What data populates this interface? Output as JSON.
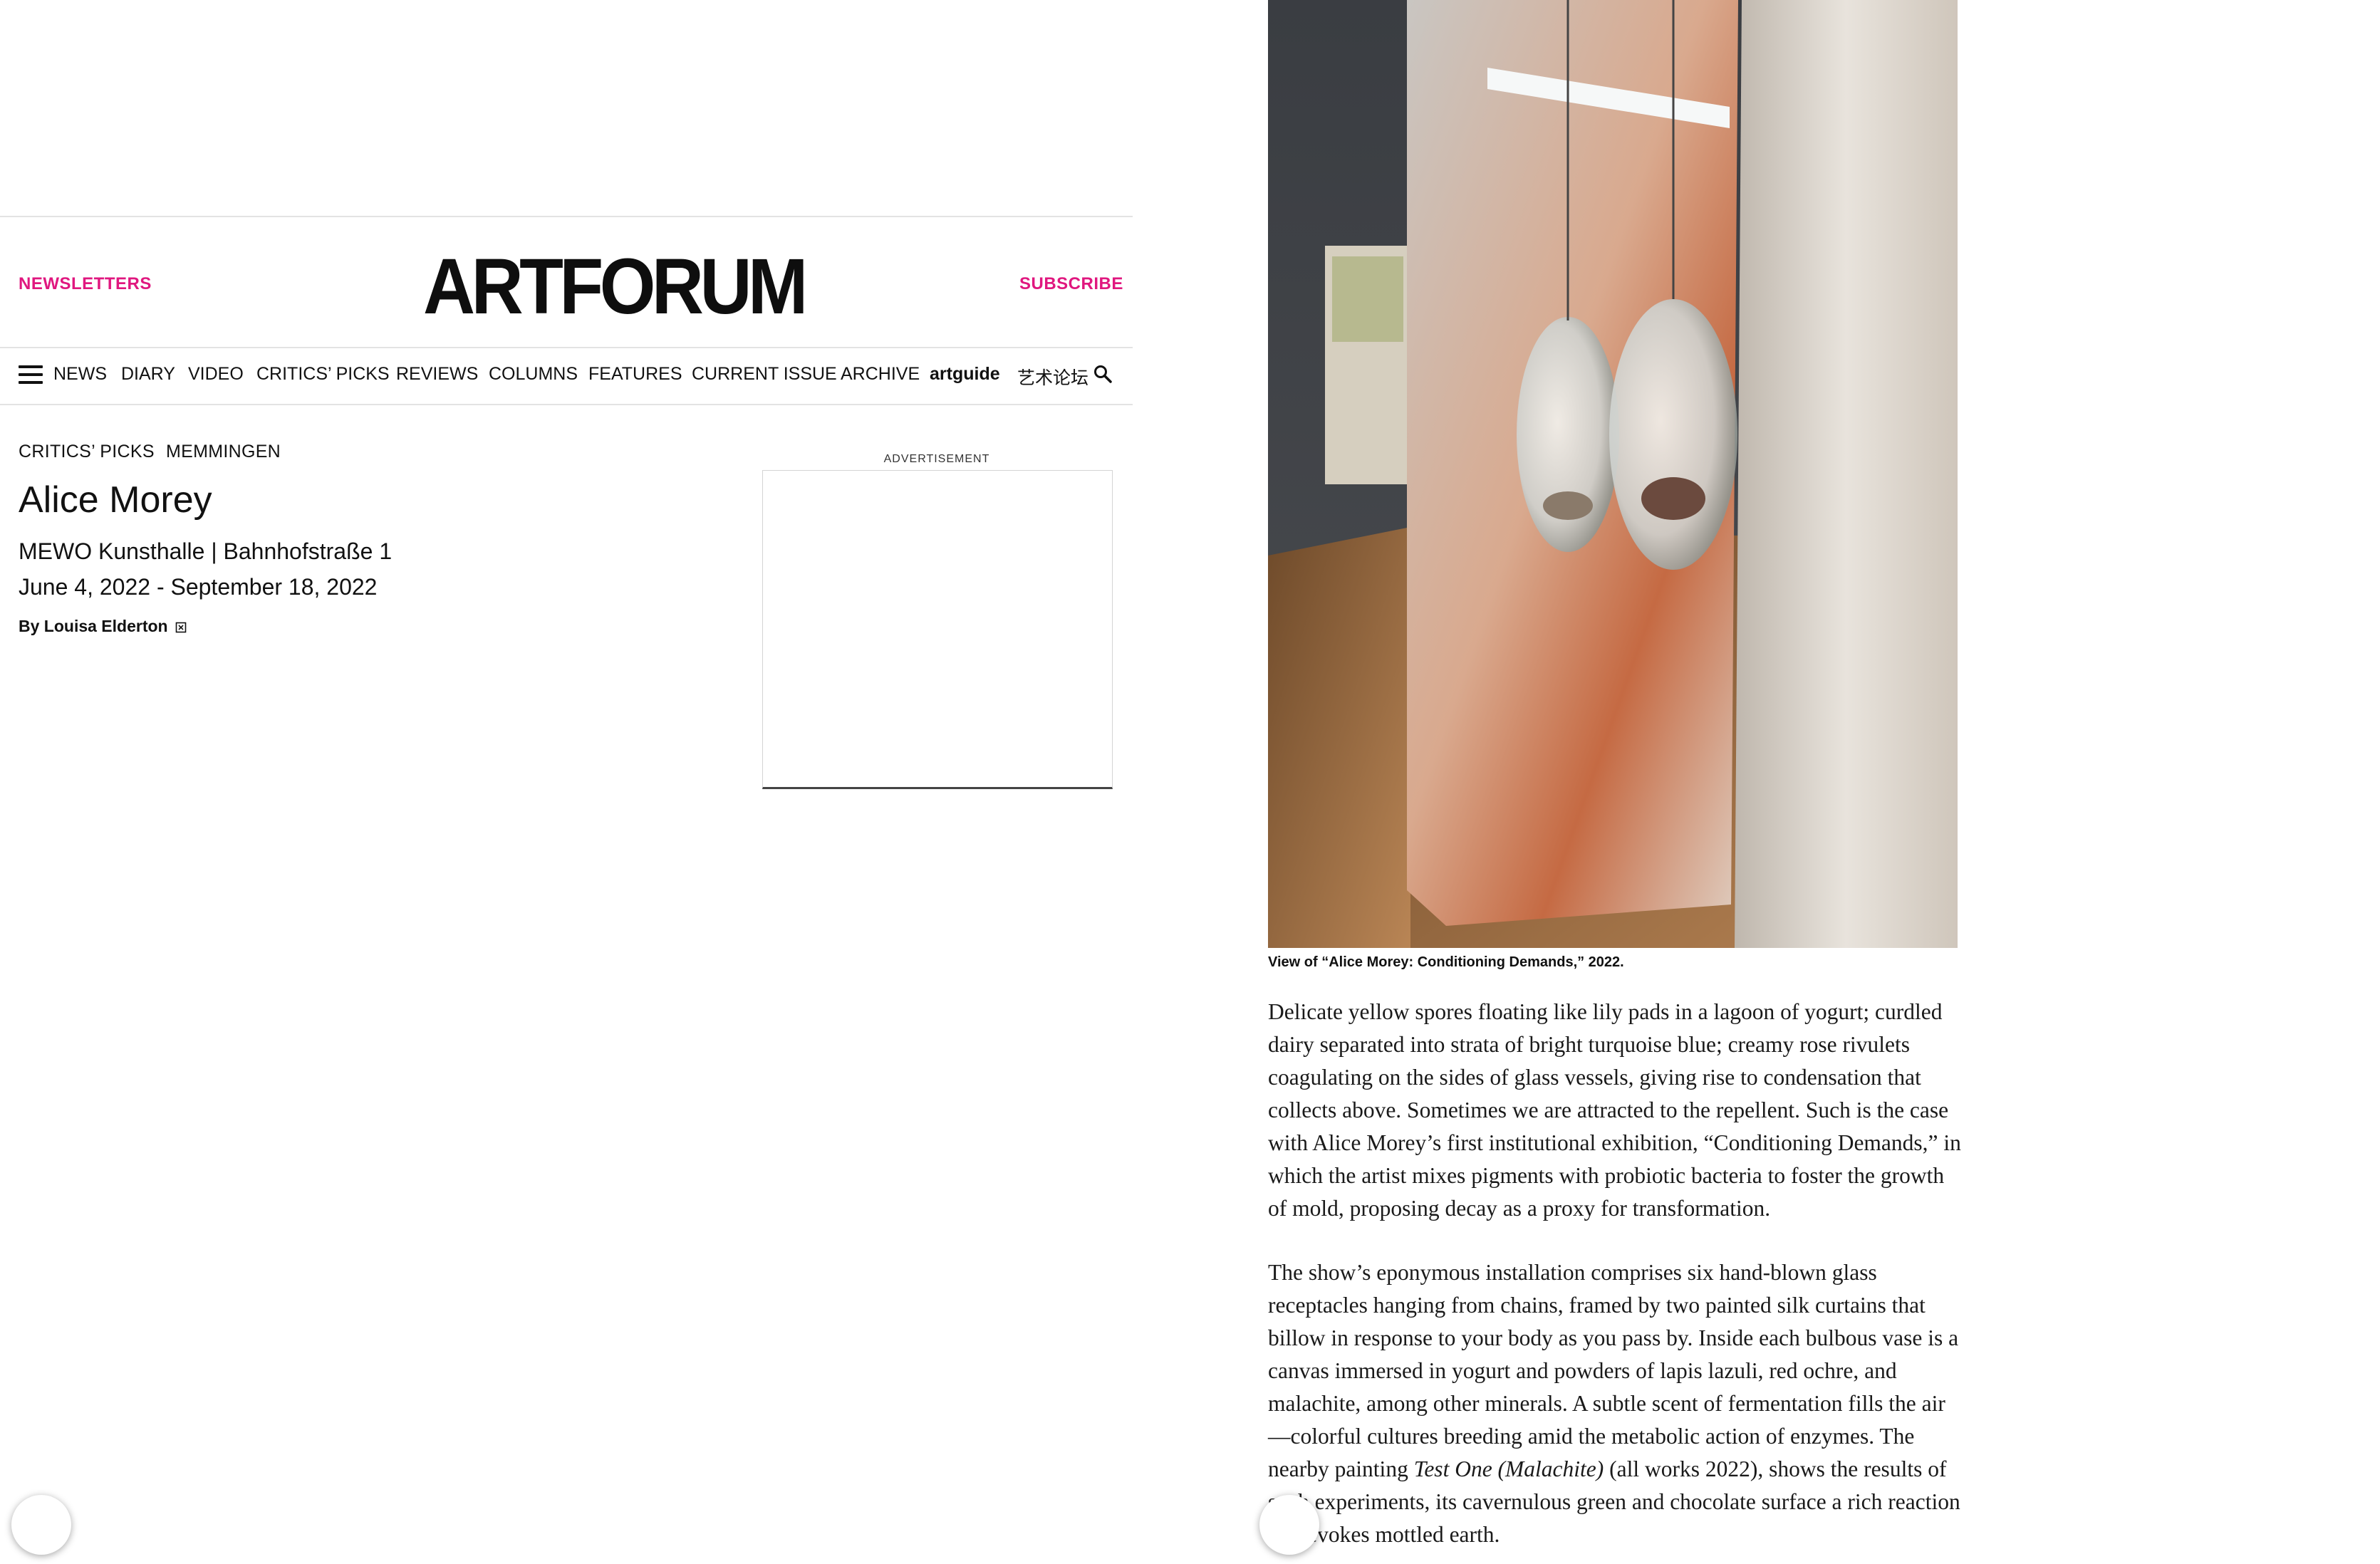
{
  "header": {
    "newsletters_label": "NEWSLETTERS",
    "logo_text": "ARTFORUM",
    "subscribe_label": "SUBSCRIBE",
    "accent_color": "#e0177f"
  },
  "nav": {
    "items": [
      "NEWS",
      "DIARY",
      "VIDEO",
      "CRITICS’ PICKS",
      "REVIEWS",
      "COLUMNS",
      "FEATURES",
      "CURRENT ISSUE",
      "ARCHIVE",
      "artguide",
      "艺术论坛"
    ],
    "menu_icon": "hamburger-menu-icon",
    "search_icon": "search-icon"
  },
  "article_meta": {
    "section": "CRITICS’ PICKS",
    "city": "MEMMINGEN",
    "title": "Alice Morey",
    "venue": "MEWO Kunsthalle | Bahnhofstraße 1",
    "dates": "June 4, 2022 - September 18, 2022",
    "byline": "By Louisa Elderton"
  },
  "advertisement": {
    "label": "ADVERTISEMENT"
  },
  "image": {
    "caption": "View of “Alice Morey: Conditioning Demands,” 2022."
  },
  "body": {
    "p1": "Delicate yellow spores floating like lily pads in a lagoon of yogurt; curdled dairy separated into strata of bright turquoise blue; creamy rose rivulets coagulating on the sides of glass vessels, giving rise to condensation that collects above. Sometimes we are attracted to the repellent. Such is the case with Alice Morey’s first institutional exhibition, “Conditioning Demands,” in which the artist mixes pigments with probiotic bacteria to foster the growth of mold, proposing decay as a proxy for transformation.",
    "p2_a": "The show’s eponymous installation comprises six hand-blown glass receptacles hanging from chains, framed by two painted silk curtains that billow in response to your body as you pass by. Inside each bulbous vase is a canvas immersed in yogurt and powders of lapis lazuli, red ochre, and malachite, among other minerals. A subtle scent of fermentation fills the air—colorful cultures breeding amid the metabolic action of enzymes. The nearby painting ",
    "p2_italic": "Test One (Malachite)",
    "p2_b": " (all works 2022), shows the results of such experiments, its cavernulous green and chocolate surface a rich reaction that evokes mottled earth."
  }
}
